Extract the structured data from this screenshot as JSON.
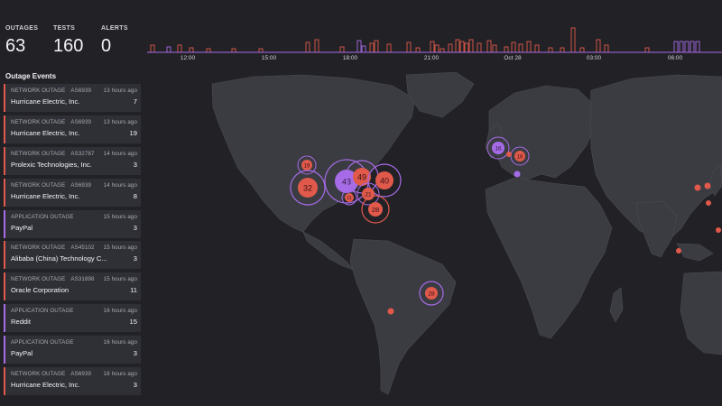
{
  "stats": [
    {
      "label": "OUTAGES",
      "value": "63"
    },
    {
      "label": "TESTS",
      "value": "160"
    },
    {
      "label": "ALERTS",
      "value": "0"
    }
  ],
  "timeline": {
    "labels": [
      "12:00",
      "15:00",
      "18:00",
      "21:00",
      "Oct 28",
      "03:00",
      "06:00"
    ]
  },
  "events_title": "Outage Events",
  "events": [
    {
      "type": "NETWORK OUTAGE",
      "asn": "AS6939",
      "time": "13 hours ago",
      "name": "Hurricane Electric, Inc.",
      "count": "7",
      "kind": "network"
    },
    {
      "type": "NETWORK OUTAGE",
      "asn": "AS6939",
      "time": "13 hours ago",
      "name": "Hurricane Electric, Inc.",
      "count": "19",
      "kind": "network"
    },
    {
      "type": "NETWORK OUTAGE",
      "asn": "AS32787",
      "time": "14 hours ago",
      "name": "Prolexic Technologies, Inc.",
      "count": "3",
      "kind": "network"
    },
    {
      "type": "NETWORK OUTAGE",
      "asn": "AS6939",
      "time": "14 hours ago",
      "name": "Hurricane Electric, Inc.",
      "count": "8",
      "kind": "network"
    },
    {
      "type": "APPLICATION OUTAGE",
      "asn": "",
      "time": "15 hours ago",
      "name": "PayPal",
      "count": "3",
      "kind": "application"
    },
    {
      "type": "NETWORK OUTAGE",
      "asn": "AS45102",
      "time": "15 hours ago",
      "name": "Alibaba (China) Technology C...",
      "count": "3",
      "kind": "network"
    },
    {
      "type": "NETWORK OUTAGE",
      "asn": "AS31898",
      "time": "15 hours ago",
      "name": "Oracle Corporation",
      "count": "11",
      "kind": "network"
    },
    {
      "type": "APPLICATION OUTAGE",
      "asn": "",
      "time": "16 hours ago",
      "name": "Reddit",
      "count": "15",
      "kind": "application"
    },
    {
      "type": "APPLICATION OUTAGE",
      "asn": "",
      "time": "16 hours ago",
      "name": "PayPal",
      "count": "3",
      "kind": "application"
    },
    {
      "type": "NETWORK OUTAGE",
      "asn": "AS6939",
      "time": "18 hours ago",
      "name": "Hurricane Electric, Inc.",
      "count": "3",
      "kind": "network"
    }
  ],
  "map_clusters": [
    {
      "label": "19",
      "color": "#e0594b",
      "ring": "#a66be6"
    },
    {
      "label": "32",
      "color": "#e0594b",
      "ring": "#a66be6"
    },
    {
      "label": "43",
      "color": "#a66be6",
      "ring": "#a66be6"
    },
    {
      "label": "49",
      "color": "#e0594b",
      "ring": "#a66be6"
    },
    {
      "label": "40",
      "color": "#e0594b",
      "ring": "#a66be6"
    },
    {
      "label": "21",
      "color": "#e0594b",
      "ring": "#a66be6"
    },
    {
      "label": "11",
      "color": "#e0594b",
      "ring": "#a66be6"
    },
    {
      "label": "28",
      "color": "#e0594b",
      "ring": "#e0594b"
    },
    {
      "label": "16",
      "color": "#a66be6",
      "ring": "#a66be6"
    },
    {
      "label": "18",
      "color": "#e0594b",
      "ring": "#a66be6"
    },
    {
      "label": "28",
      "color": "#e0594b",
      "ring": "#a66be6"
    }
  ],
  "colors": {
    "network": "#e0594b",
    "application": "#a66be6",
    "land": "#3b3c42",
    "background": "#222226"
  }
}
